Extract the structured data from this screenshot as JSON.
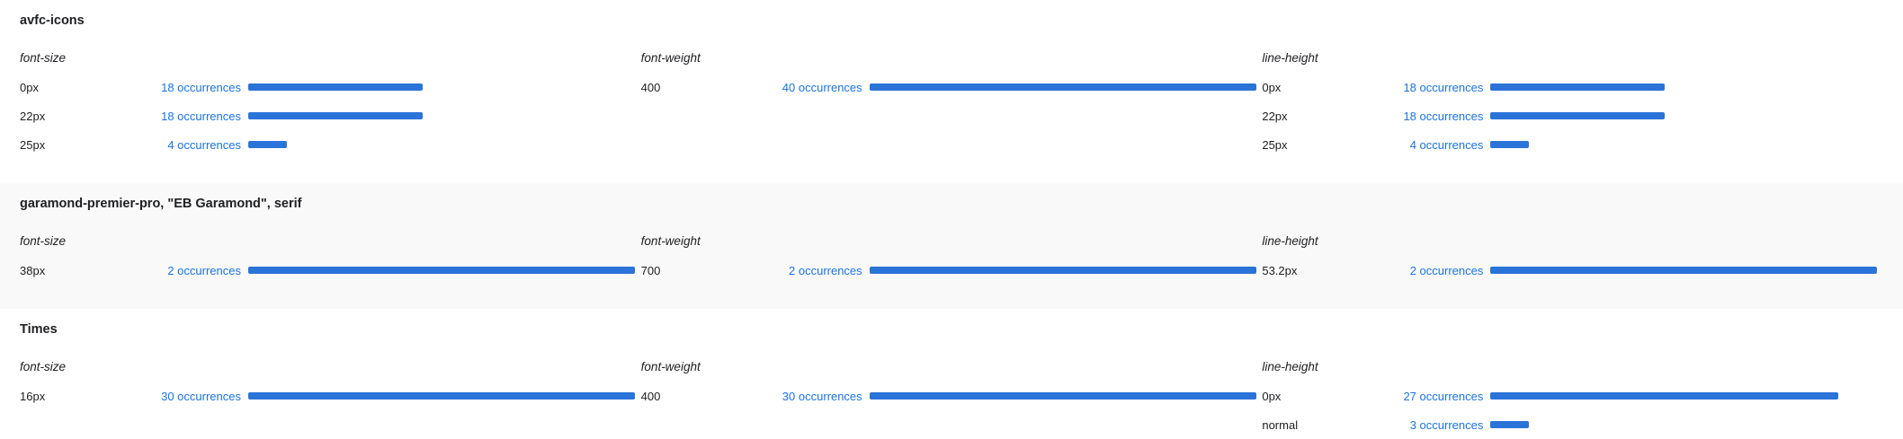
{
  "accent_color": "#2a73d9",
  "link_color": "#1a73e8",
  "sections": [
    {
      "title": "avfc-icons",
      "shaded": false,
      "columns": [
        {
          "label": "font-size",
          "rows": [
            {
              "value": "0px",
              "occurrences": "18 occurrences",
              "fraction": 0.45
            },
            {
              "value": "22px",
              "occurrences": "18 occurrences",
              "fraction": 0.45
            },
            {
              "value": "25px",
              "occurrences": "4 occurrences",
              "fraction": 0.1
            }
          ]
        },
        {
          "label": "font-weight",
          "rows": [
            {
              "value": "400",
              "occurrences": "40 occurrences",
              "fraction": 1.0
            }
          ]
        },
        {
          "label": "line-height",
          "rows": [
            {
              "value": "0px",
              "occurrences": "18 occurrences",
              "fraction": 0.45
            },
            {
              "value": "22px",
              "occurrences": "18 occurrences",
              "fraction": 0.45
            },
            {
              "value": "25px",
              "occurrences": "4 occurrences",
              "fraction": 0.1
            }
          ]
        }
      ]
    },
    {
      "title": "garamond-premier-pro, \"EB Garamond\", serif",
      "shaded": true,
      "columns": [
        {
          "label": "font-size",
          "rows": [
            {
              "value": "38px",
              "occurrences": "2 occurrences",
              "fraction": 1.0
            }
          ]
        },
        {
          "label": "font-weight",
          "rows": [
            {
              "value": "700",
              "occurrences": "2 occurrences",
              "fraction": 1.0
            }
          ]
        },
        {
          "label": "line-height",
          "rows": [
            {
              "value": "53.2px",
              "occurrences": "2 occurrences",
              "fraction": 1.0
            }
          ]
        }
      ]
    },
    {
      "title": "Times",
      "shaded": false,
      "columns": [
        {
          "label": "font-size",
          "rows": [
            {
              "value": "16px",
              "occurrences": "30 occurrences",
              "fraction": 1.0
            }
          ]
        },
        {
          "label": "font-weight",
          "rows": [
            {
              "value": "400",
              "occurrences": "30 occurrences",
              "fraction": 1.0
            }
          ]
        },
        {
          "label": "line-height",
          "rows": [
            {
              "value": "0px",
              "occurrences": "27 occurrences",
              "fraction": 0.9
            },
            {
              "value": "normal",
              "occurrences": "3 occurrences",
              "fraction": 0.1
            }
          ]
        }
      ]
    }
  ]
}
